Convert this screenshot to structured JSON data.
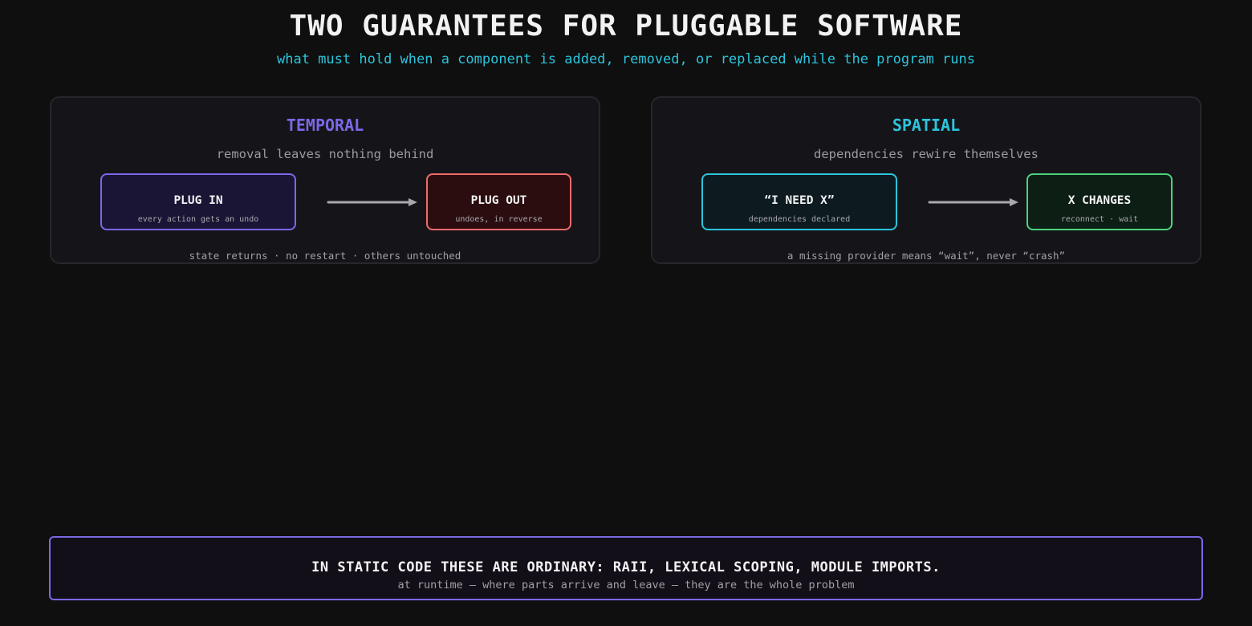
{
  "title": "TWO GUARANTEES FOR PLUGGABLE SOFTWARE",
  "subtitle": "what must hold when a component is added, removed, or replaced while the program runs",
  "panels": [
    {
      "heading": "TEMPORAL",
      "heading_color": "#7b68e8",
      "subheading": "removal leaves nothing behind",
      "from_node": {
        "label": "PLUG IN",
        "caption": "every action gets an undo",
        "border_color": "#7b68e8",
        "fill_color": "#1b1535"
      },
      "to_node": {
        "label": "PLUG OUT",
        "caption": "undoes, in reverse",
        "border_color": "#ef6b6b",
        "fill_color": "#2b0d0f"
      },
      "footer": "state returns · no restart · others untouched"
    },
    {
      "heading": "SPATIAL",
      "heading_color": "#2cc4dc",
      "subheading": "dependencies rewire themselves",
      "from_node": {
        "label": "“I NEED X”",
        "caption": "dependencies declared",
        "border_color": "#2cc4dc",
        "fill_color": "#0d1b21"
      },
      "to_node": {
        "label": "X CHANGES",
        "caption": "reconnect · wait",
        "border_color": "#4cd27c",
        "fill_color": "#0d1e15"
      },
      "footer": "a missing provider means “wait”, never “crash”"
    }
  ],
  "banner": {
    "main": "IN STATIC CODE THESE ARE ORDINARY: RAII, LEXICAL SCOPING, MODULE IMPORTS.",
    "sub": "at runtime — where parts arrive and leave — they are the whole problem"
  },
  "colors": {
    "background": "#0f0f0f",
    "arrow": "#a8a8ae"
  }
}
